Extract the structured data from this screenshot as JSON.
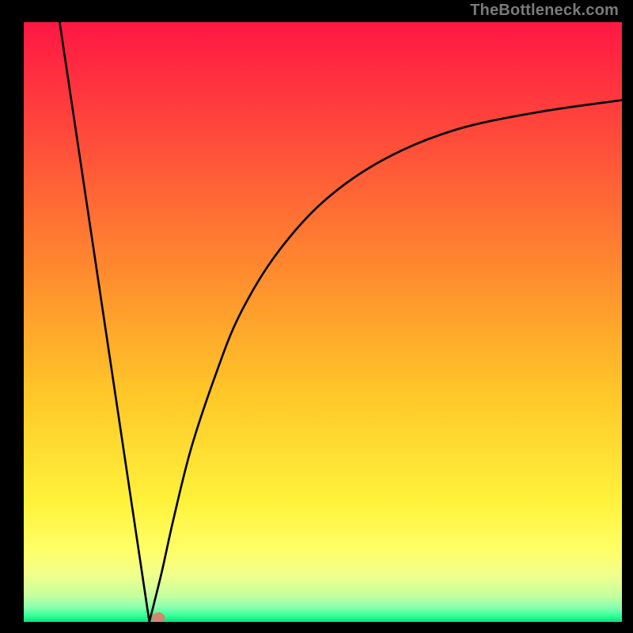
{
  "attribution": "TheBottleneck.com",
  "colors": {
    "frame": "#000000",
    "watermark": "#7a7a7a",
    "curve": "#000000",
    "marker": "#cf8a6f",
    "gradient_stops": [
      {
        "offset": 0.0,
        "color": "#ff1744"
      },
      {
        "offset": 0.2,
        "color": "#ff4d3a"
      },
      {
        "offset": 0.42,
        "color": "#ff8c2e"
      },
      {
        "offset": 0.62,
        "color": "#ffc728"
      },
      {
        "offset": 0.8,
        "color": "#fff23b"
      },
      {
        "offset": 0.88,
        "color": "#ffff66"
      },
      {
        "offset": 0.92,
        "color": "#f2ff8a"
      },
      {
        "offset": 0.955,
        "color": "#c8ff9e"
      },
      {
        "offset": 0.975,
        "color": "#8cffb0"
      },
      {
        "offset": 0.99,
        "color": "#33ff99"
      },
      {
        "offset": 1.0,
        "color": "#00e676"
      }
    ]
  },
  "chart_data": {
    "type": "line",
    "title": "",
    "xlabel": "",
    "ylabel": "",
    "xlim": [
      0,
      100
    ],
    "ylim": [
      0,
      100
    ],
    "left_segment": {
      "comment": "steep descending line from top-left toward the minimum",
      "x0": 6,
      "y0": 100,
      "x1": 21,
      "y1": 0
    },
    "right_curve": {
      "comment": "monotone rising saturating curve from the minimum toward upper right",
      "x": [
        21,
        23,
        25,
        28,
        32,
        36,
        42,
        50,
        60,
        72,
        86,
        100
      ],
      "y": [
        0,
        8,
        17,
        29,
        41,
        51,
        61,
        70,
        77,
        82,
        85,
        87
      ]
    },
    "marker": {
      "x": 22.5,
      "y": 0.7
    }
  }
}
